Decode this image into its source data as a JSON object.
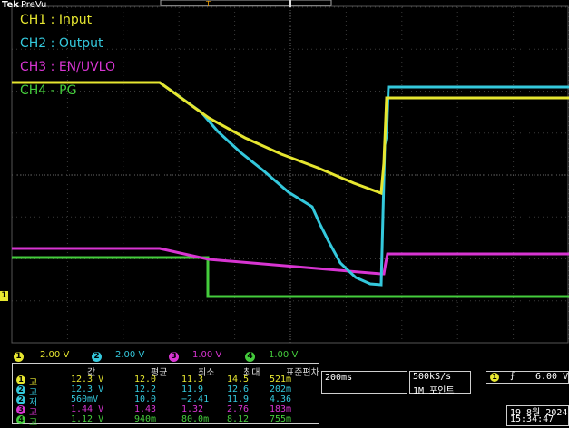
{
  "brand": {
    "tek": "Tek",
    "mode": "PreVu"
  },
  "legend": [
    {
      "label": "CH1 : Input",
      "color": "#e6e630"
    },
    {
      "label": "CH2 : Output",
      "color": "#34c8dc"
    },
    {
      "label": "CH3 : EN/UVLO",
      "color": "#d835d2"
    },
    {
      "label": "CH4 - PG",
      "color": "#44cc3c"
    }
  ],
  "ground_marker": "1",
  "channel_scales": [
    {
      "num": "1",
      "value": "2.00 V",
      "color": "#e6e630"
    },
    {
      "num": "2",
      "value": "2.00 V",
      "color": "#34c8dc"
    },
    {
      "num": "3",
      "value": "1.00 V",
      "color": "#d835d2"
    },
    {
      "num": "4",
      "value": "1.00 V",
      "color": "#44cc3c"
    }
  ],
  "measurements": {
    "headers": [
      "값",
      "평균",
      "최소",
      "최대",
      "표준편차"
    ],
    "rows": [
      {
        "num": "1",
        "kind": "고",
        "color": "#e6e630",
        "cells": [
          "12.3 V",
          "12.0",
          "11.3",
          "14.5",
          "521m"
        ]
      },
      {
        "num": "2",
        "kind": "고",
        "color": "#34c8dc",
        "cells": [
          "12.3 V",
          "12.2",
          "11.9",
          "12.6",
          "202m"
        ]
      },
      {
        "num": "2",
        "kind": "저",
        "color": "#34c8dc",
        "cells": [
          "560mV",
          "10.0",
          "−2.41",
          "11.9",
          "4.36"
        ]
      },
      {
        "num": "3",
        "kind": "고",
        "color": "#d835d2",
        "cells": [
          "1.44 V",
          "1.43",
          "1.32",
          "2.76",
          "183m"
        ]
      },
      {
        "num": "4",
        "kind": "고",
        "color": "#44cc3c",
        "cells": [
          "1.12 V",
          "940m",
          "80.0m",
          "8.12",
          "755m"
        ]
      }
    ]
  },
  "timebase": "200ms",
  "sample_rate": "500kS/s",
  "record_length": "1M 포인트",
  "trigger": {
    "channel": "1",
    "slope": "⨍",
    "level": "6.00 V"
  },
  "date": "19 8월 2024",
  "time": "15:34:47",
  "trigger_marker": "T"
}
